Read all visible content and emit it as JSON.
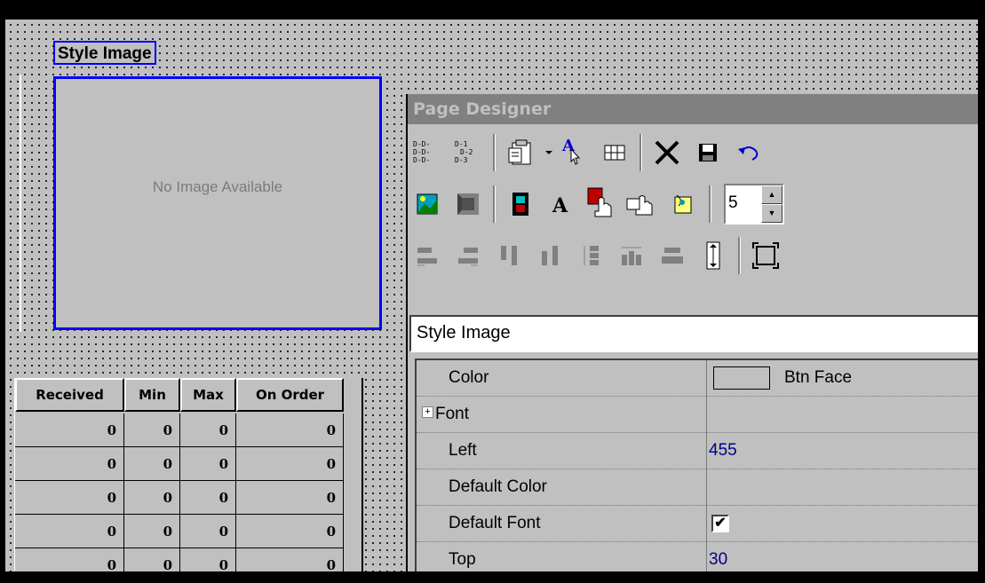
{
  "label_text": "Style Image",
  "image_placeholder": "No Image Available",
  "grid": {
    "headers": [
      "Received",
      "Min",
      "Max",
      "On Order"
    ],
    "rows": [
      [
        "0",
        "0",
        "0",
        "0"
      ],
      [
        "0",
        "0",
        "0",
        "0"
      ],
      [
        "0",
        "0",
        "0",
        "0"
      ],
      [
        "0",
        "0",
        "0",
        "0"
      ],
      [
        "0",
        "0",
        "0",
        "0"
      ]
    ]
  },
  "designer": {
    "title": "Page Designer",
    "spin_value": "5",
    "selected_name": "Style Image"
  },
  "properties": {
    "color_label": "Color",
    "color_value": "Btn Face",
    "font_label": "Font",
    "left_label": "Left",
    "left_value": "455",
    "default_color_label": "Default Color",
    "default_font_label": "Default Font",
    "default_font_checked": true,
    "top_label": "Top",
    "top_value": "30"
  },
  "icons": [
    "list-icon",
    "numbered-list-icon",
    "properties-icon",
    "dropdown-arrow-icon",
    "text-pointer-icon",
    "grid-icon",
    "delete-icon",
    "save-icon",
    "undo-icon",
    "image-icon",
    "frame-icon",
    "film-icon",
    "font-icon",
    "hand-select-icon",
    "hand-pointer-icon",
    "note-icon",
    "align-left-icon",
    "align-right-icon",
    "align-top-icon",
    "align-bottom-icon",
    "space-vertical-icon",
    "space-horizontal-icon",
    "center-horizontal-icon",
    "center-vertical-icon",
    "size-icon"
  ]
}
